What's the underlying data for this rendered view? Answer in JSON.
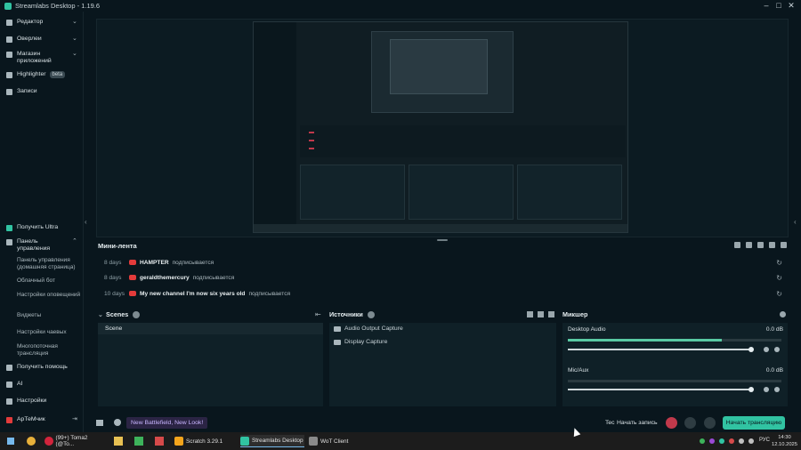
{
  "window": {
    "title": "Streamlabs Desktop - 1.19.6",
    "buttons": [
      "–",
      "□",
      "✕"
    ]
  },
  "sidebar": {
    "top": [
      {
        "label": "Редактор",
        "icon": "editor-icon",
        "expand": true
      },
      {
        "label": "Оверлеи",
        "icon": "overlays-icon",
        "expand": true
      },
      {
        "label": "Магазин приложений",
        "icon": "app-store-icon",
        "expand": true
      },
      {
        "label": "Highlighter",
        "icon": "highlighter-icon",
        "badge": "beta"
      },
      {
        "label": "Записи",
        "icon": "recordings-icon"
      }
    ],
    "bottom": {
      "ultra": "Получить Ultra",
      "settings_group": "Панель управления",
      "sub_items": [
        "Панель управления (домашняя страница)",
        "Облачный бот",
        "Настройки оповещений",
        "Виджеты",
        "Настройки чаевых",
        "Многопоточная трансляция"
      ],
      "help": "Получить помощь",
      "ai": "AI",
      "settings": "Настройки",
      "account": "АрТеМчик"
    }
  },
  "feed": {
    "title": "Мини-лента",
    "rows": [
      {
        "when": "8 days",
        "who": "HAMPTER",
        "what": "подписывается"
      },
      {
        "when": "8 days",
        "who": "geraldthemercury",
        "what": "подписывается"
      },
      {
        "when": "10 days",
        "who": "My new channel I'm now six years old",
        "what": "подписывается"
      }
    ]
  },
  "scenes": {
    "title": "Scenes",
    "items": [
      "Scene"
    ]
  },
  "sources": {
    "title": "Источники",
    "items": [
      "Audio Output Capture",
      "Display Capture"
    ]
  },
  "mixer": {
    "title": "Микшер",
    "channels": [
      {
        "name": "Desktop Audio",
        "db": "0.0 dB",
        "level": 0.72
      },
      {
        "name": "Mic/Aux",
        "db": "0.0 dB",
        "level": 0.0
      }
    ]
  },
  "bottombar": {
    "promo": "New Battlefield, New Look!",
    "tes": "Tec",
    "record": "Начать запись",
    "go_live": "Начать трансляцию"
  },
  "taskbar": {
    "apps": [
      "(99+) Toma2 (@To...",
      "Scratch 3.29.1",
      "Streamlabs Desktop",
      "WoT Client"
    ],
    "lang": "РУС",
    "time": "14:30",
    "date": "12.10.2025"
  },
  "colors": {
    "accent": "#31c3a2",
    "youtube": "#e33b3b",
    "bg": "#09161d"
  }
}
